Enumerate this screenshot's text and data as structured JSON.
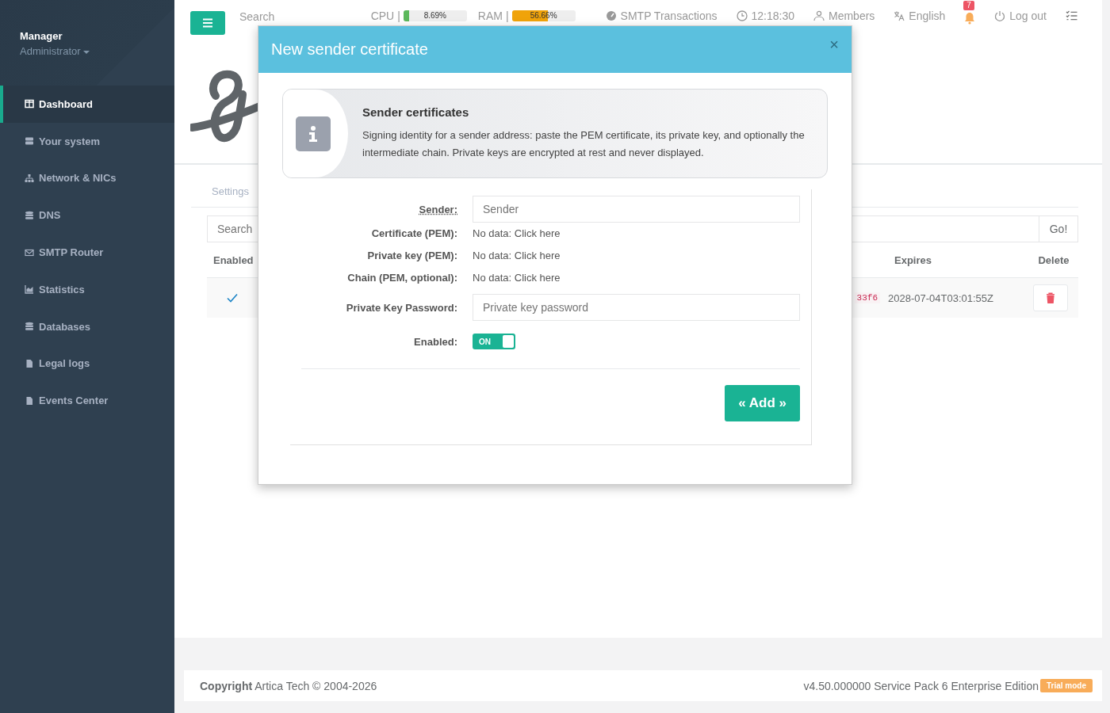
{
  "sidebar": {
    "user_name": "Manager",
    "role": "Administrator",
    "items": [
      {
        "label": "Dashboard",
        "selected": true
      },
      {
        "label": "Your system",
        "selected": false
      },
      {
        "label": "Network & NICs",
        "selected": false
      },
      {
        "label": "DNS",
        "selected": false
      },
      {
        "label": "SMTP Router",
        "selected": false
      },
      {
        "label": "Statistics",
        "selected": false
      },
      {
        "label": "Databases",
        "selected": false
      },
      {
        "label": "Legal logs",
        "selected": false
      },
      {
        "label": "Events Center",
        "selected": false
      }
    ]
  },
  "topbar": {
    "search_placeholder": "Search",
    "meters": [
      {
        "label": "CPU",
        "separator": "|",
        "reading": "8.69%",
        "level": 0.087,
        "color": "#5cb85c"
      },
      {
        "label": "RAM",
        "separator": "|",
        "reading": "56.66%",
        "level": 0.5666,
        "color": "#f0a30a"
      }
    ],
    "links": [
      {
        "label": "SMTP Transactions"
      },
      {
        "label": "12:18:30"
      },
      {
        "label": "Members"
      },
      {
        "label": "English"
      }
    ],
    "notifications": "7",
    "logout": "Log out"
  },
  "page": {
    "tab": "Settings",
    "search_placeholder": "Search",
    "go_button": "Go!",
    "columns": [
      "Enabled",
      "Expires",
      "Delete"
    ],
    "rows": [
      {
        "enabled": true,
        "column_2": "33f6",
        "expires": "2028-07-04T03:01:55Z"
      }
    ]
  },
  "modal": {
    "title": "New sender certificate",
    "close": "×",
    "info_title": "Sender certificates",
    "info_text": "Signing identity for a sender address: paste the PEM certificate, its private key, and optionally the intermediate chain. Private keys are encrypted at rest and never displayed.",
    "fields": [
      {
        "kind": "input",
        "label": "Sender:",
        "placeholder": "Sender",
        "hint": true
      },
      {
        "kind": "file",
        "label": "Certificate (PEM):",
        "value": "No data: Click here"
      },
      {
        "kind": "file",
        "label": "Private key (PEM):",
        "value": "No data: Click here"
      },
      {
        "kind": "file",
        "label": "Chain (PEM, optional):",
        "value": "No data: Click here"
      },
      {
        "kind": "input",
        "label": "Private Key Password:",
        "placeholder": "Private key password",
        "hint": false
      },
      {
        "kind": "toggle",
        "label": "Enabled:",
        "on": true,
        "text": "ON"
      }
    ],
    "add_button": "« Add »"
  },
  "footer": {
    "copyright": "**Copyright** Artica Tech © 2004-2026",
    "version": "v4.50.000000 Service Pack 6 Enterprise Edition",
    "badge": "Trial mode"
  }
}
